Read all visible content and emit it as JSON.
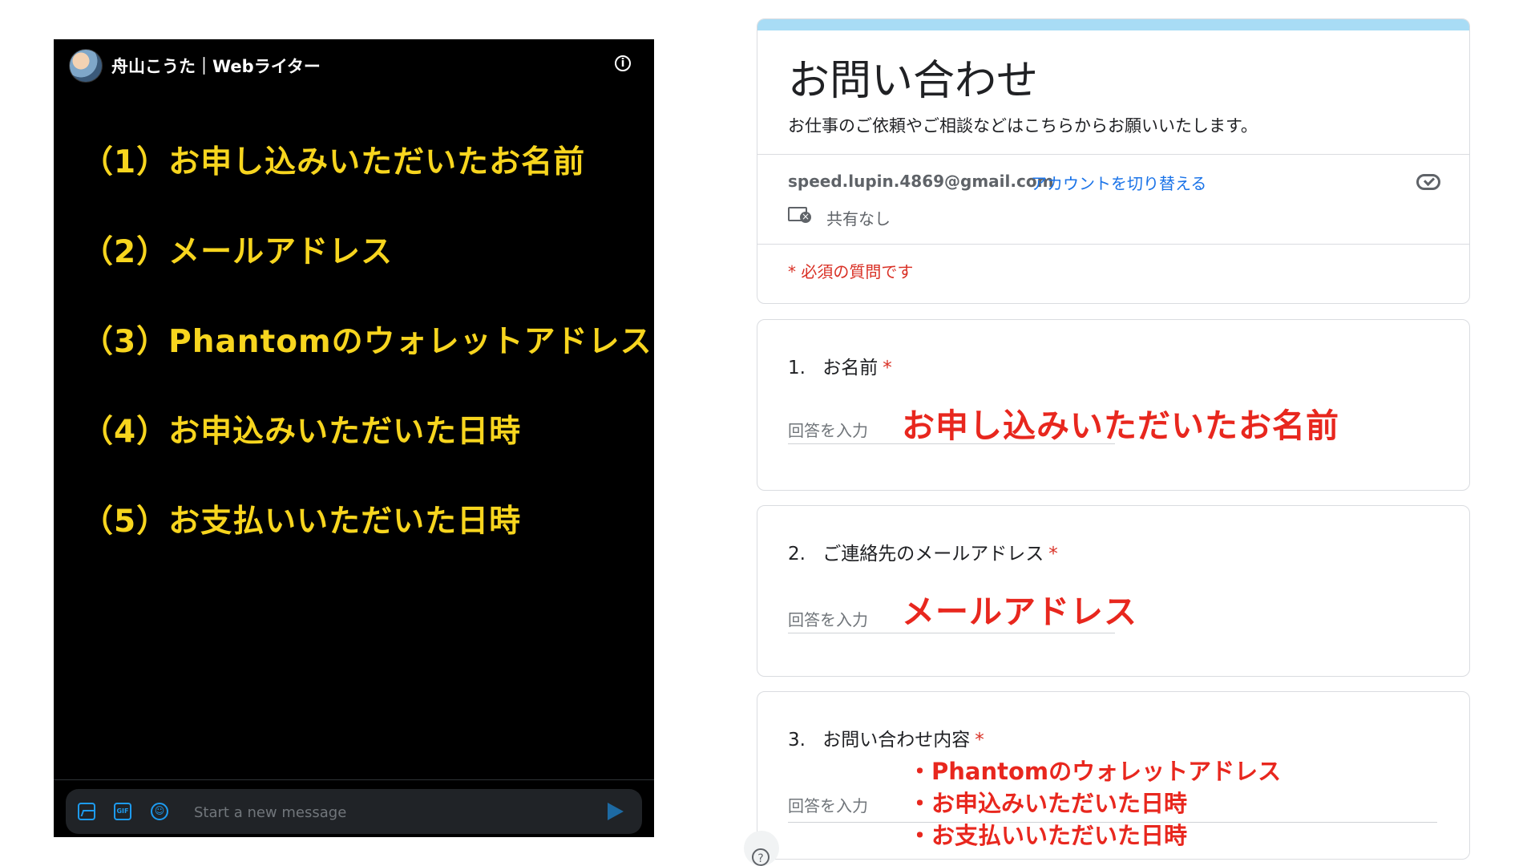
{
  "dm": {
    "header": {
      "name": "舟山こうた｜Webライター",
      "info_icon": "info-icon"
    },
    "items": [
      "（1）お申し込みいただいたお名前",
      "（2）メールアドレス",
      "（3）Phantomのウォレットアドレス",
      "（4）お申込みいただいた日時",
      "（5）お支払いいただいた日時"
    ],
    "composer": {
      "placeholder": "Start a new message",
      "gif_label": "GIF",
      "icons": [
        "image-icon",
        "gif-icon",
        "emoji-icon",
        "send-icon"
      ]
    },
    "colors": {
      "item_text": "#f7d51e",
      "accent": "#1d9bf0",
      "background": "#000000"
    }
  },
  "form": {
    "title": "お問い合わせ",
    "description": "お仕事のご依頼やご相談などはこちらからお願いいたします。",
    "account_email": "speed.lupin.4869@gmail.com",
    "switch_account": "アカウントを切り替える",
    "share_status": "共有なし",
    "required_note": "* 必須の質問です",
    "questions": [
      {
        "number": "1.",
        "label": "お名前",
        "star": "*",
        "placeholder": "回答を入力",
        "answer": "お申し込みいただいたお名前"
      },
      {
        "number": "2.",
        "label": "ご連絡先のメールアドレス",
        "star": "*",
        "placeholder": "回答を入力",
        "answer": "メールアドレス"
      },
      {
        "number": "3.",
        "label": "お問い合わせ内容",
        "star": "*",
        "placeholder": "回答を入力",
        "answer_lines": [
          "・Phantomのウォレットアドレス",
          "・お申込みいただいた日時",
          "・お支払いいただいた日時"
        ]
      }
    ],
    "colors": {
      "header_bar": "#a8dcf5",
      "link": "#1a73e8",
      "required": "#d93025",
      "annotation": "#e8271e"
    }
  },
  "help": {
    "icon": "help-icon",
    "glyph": "?"
  }
}
